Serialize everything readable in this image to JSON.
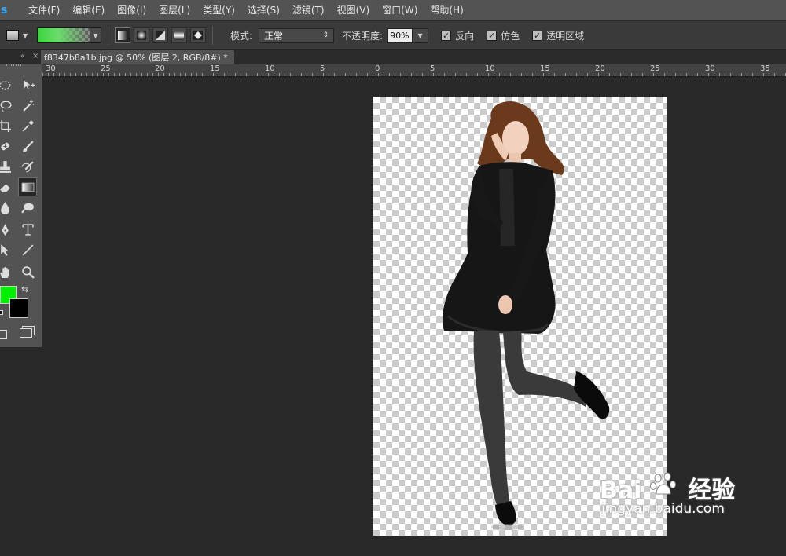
{
  "app": {
    "logo": "s"
  },
  "menu": [
    "文件(F)",
    "编辑(E)",
    "图像(I)",
    "图层(L)",
    "类型(Y)",
    "选择(S)",
    "滤镜(T)",
    "视图(V)",
    "窗口(W)",
    "帮助(H)"
  ],
  "options": {
    "mode_label": "模式:",
    "mode_value": "正常",
    "opacity_label": "不透明度:",
    "opacity_value": "90%",
    "reverse_label": "反向",
    "dither_label": "仿色",
    "transparency_label": "透明区域",
    "reverse_checked": true,
    "dither_checked": true,
    "transparency_checked": true,
    "gradient_colors": [
      "#39d63f",
      "#6cdc6c",
      "transparent"
    ]
  },
  "document_tab": {
    "title": "f8347b8a1b.jpg @ 50% (图层 2, RGB/8#) *",
    "close": "×"
  },
  "ruler": {
    "labels": [
      "30",
      "25",
      "20",
      "15",
      "10",
      "5",
      "0",
      "5",
      "10",
      "15",
      "20",
      "25",
      "30",
      "35"
    ]
  },
  "colors": {
    "foreground": "#00f000",
    "background": "#000000",
    "canvas_bg": "#282828",
    "panel_bg": "#535353"
  },
  "watermark": {
    "brand": "Bai",
    "suffix": "经验",
    "url": "jingyan.baidu.com"
  },
  "tools": [
    "marquee-icon",
    "move-icon",
    "lasso-icon",
    "magic-wand-icon",
    "crop-icon",
    "eyedropper-icon",
    "spot-healing-icon",
    "brush-icon",
    "clone-stamp-icon",
    "history-brush-icon",
    "eraser-icon",
    "gradient-icon",
    "blur-icon",
    "dodge-icon",
    "pen-icon",
    "type-icon",
    "path-selection-icon",
    "line-icon",
    "hand-icon",
    "zoom-icon"
  ]
}
